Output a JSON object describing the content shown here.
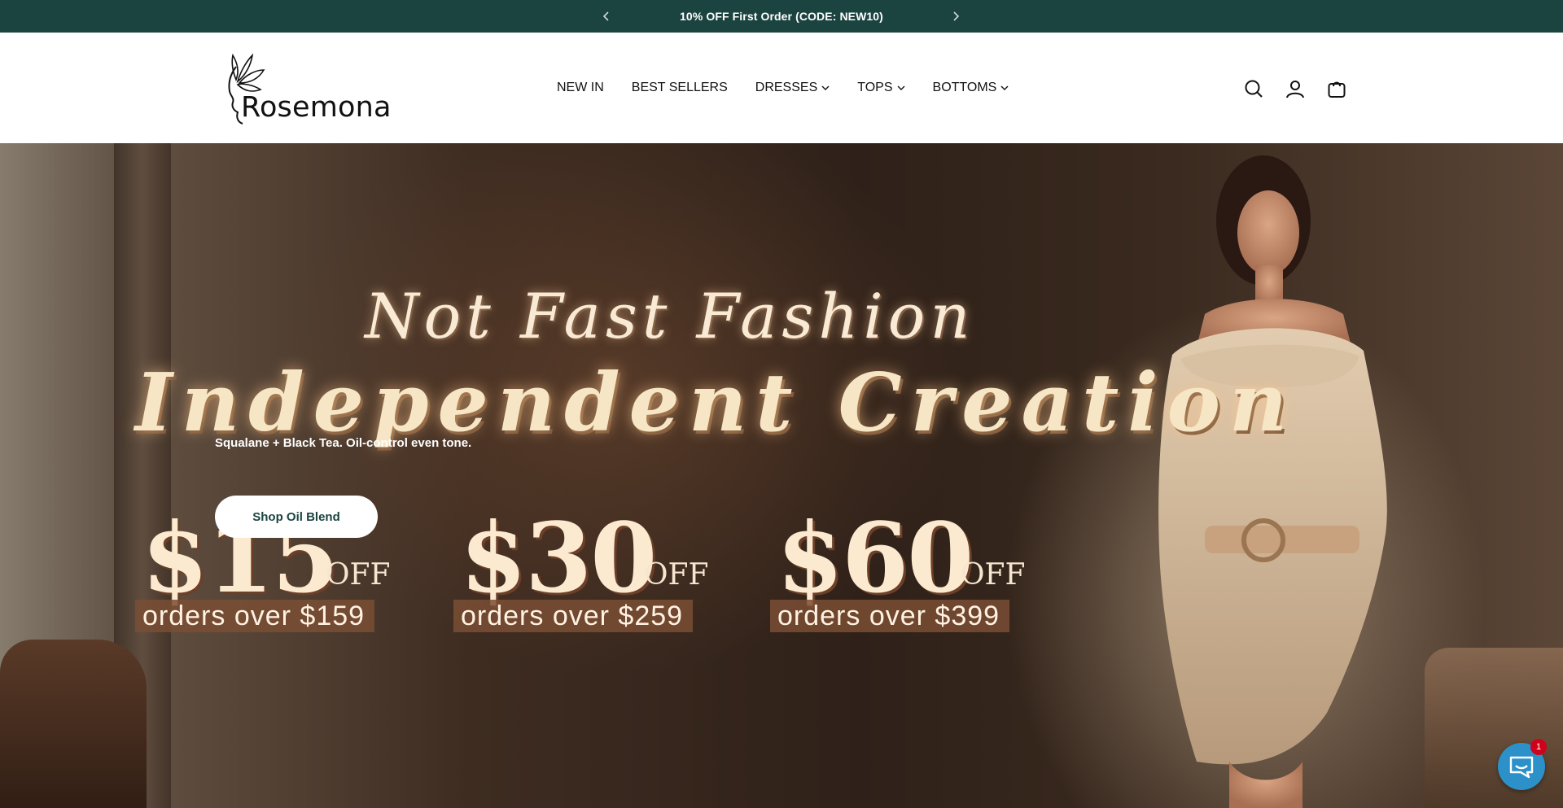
{
  "announcement": {
    "message": "10% OFF First Order (CODE: NEW10)",
    "prev_icon": "chevron-left-icon",
    "next_icon": "chevron-right-icon",
    "bg_color": "#1b4440"
  },
  "header": {
    "logo_text": "Rosemona",
    "nav": [
      {
        "label": "NEW IN",
        "has_dropdown": false
      },
      {
        "label": "BEST SELLERS",
        "has_dropdown": false
      },
      {
        "label": "DRESSES",
        "has_dropdown": true
      },
      {
        "label": "TOPS",
        "has_dropdown": true
      },
      {
        "label": "BOTTOMS",
        "has_dropdown": true
      }
    ],
    "icons": [
      "search-icon",
      "account-icon",
      "cart-icon"
    ]
  },
  "hero": {
    "tagline_1": "Not Fast Fashion",
    "tagline_2": "Independent Creation",
    "subtitle": "Squalane + Black Tea. Oil-control even tone.",
    "cta_label": "Shop Oil Blend",
    "coupons": [
      {
        "amount": "$15",
        "off": "OFF",
        "condition": "orders over $159"
      },
      {
        "amount": "$30",
        "off": "OFF",
        "condition": "orders over $259"
      },
      {
        "amount": "$60",
        "off": "OFF",
        "condition": "orders over $399"
      }
    ]
  },
  "chat": {
    "icon": "chat-icon",
    "badge_count": "1"
  }
}
